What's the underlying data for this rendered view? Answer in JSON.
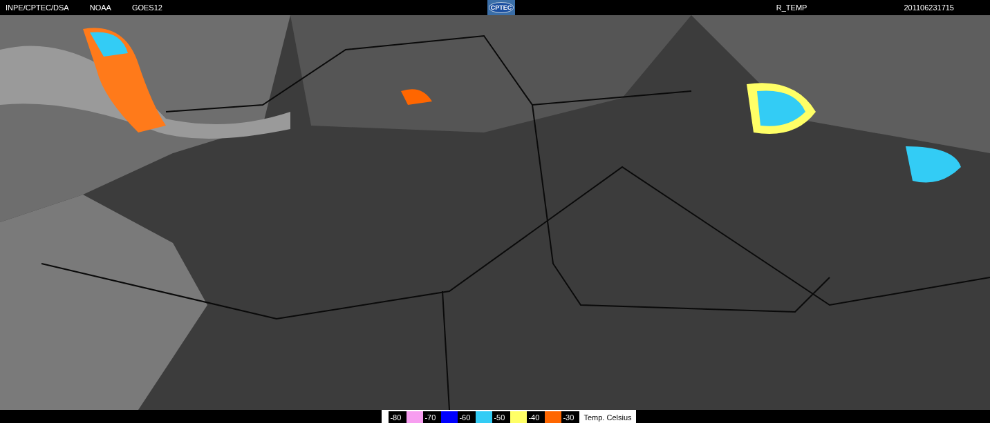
{
  "header": {
    "items": [
      "INPE/CPTEC/DSA",
      "NOAA",
      "GOES12"
    ],
    "logo": "CPTEC",
    "product": "R_TEMP",
    "timestamp": "201106231715"
  },
  "legend": {
    "scale": [
      {
        "kind": "label",
        "text": "-80"
      },
      {
        "kind": "swatch",
        "color": "#f79ef0"
      },
      {
        "kind": "label",
        "text": "-70"
      },
      {
        "kind": "swatch",
        "color": "#0000ff"
      },
      {
        "kind": "label",
        "text": "-60"
      },
      {
        "kind": "swatch",
        "color": "#33ccf5"
      },
      {
        "kind": "label",
        "text": "-50"
      },
      {
        "kind": "swatch",
        "color": "#ffff66"
      },
      {
        "kind": "label",
        "text": "-40"
      },
      {
        "kind": "swatch",
        "color": "#ff6600"
      },
      {
        "kind": "label",
        "text": "-30"
      }
    ],
    "unit": "Temp. Celsius"
  }
}
